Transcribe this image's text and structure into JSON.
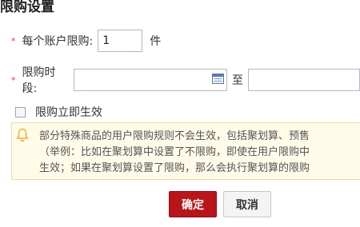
{
  "title": "限购设置",
  "limit_per_account": {
    "required_mark": "*",
    "label": "每个账户限购:",
    "value": "1",
    "unit": "件"
  },
  "limit_period": {
    "required_mark": "*",
    "label": "限购时段:",
    "start_value": "",
    "separator": "至",
    "end_value": ""
  },
  "immediate": {
    "label": "限购立即生效",
    "checked": false
  },
  "notice": {
    "lines": [
      "部分特殊商品的用户限购规则不会生效，包括聚划算、预售",
      "（举例：比如在聚划算中设置了不限购，即使在用户限购中",
      "生效；如果在聚划算设置了限购，那么会执行聚划算的限购"
    ]
  },
  "buttons": {
    "confirm": "确定",
    "cancel": "取消"
  },
  "colors": {
    "confirm_bg": "#b8161b",
    "required": "#e4393c",
    "notice_bg": "#fffbe8",
    "bell": "#e8b23a"
  }
}
